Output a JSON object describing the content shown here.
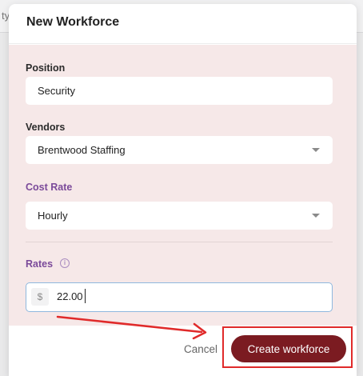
{
  "backdrop": {
    "glyph": "ty"
  },
  "modal": {
    "title": "New Workforce",
    "position": {
      "label": "Position",
      "value": "Security"
    },
    "vendors": {
      "label": "Vendors",
      "value": "Brentwood Staffing"
    },
    "cost_rate": {
      "label": "Cost Rate",
      "value": "Hourly"
    },
    "rates": {
      "label": "Rates",
      "currency_symbol": "$",
      "value": "22.00"
    },
    "footer": {
      "cancel_label": "Cancel",
      "create_label": "Create workforce"
    }
  },
  "icons": {
    "info": "info-icon",
    "caret": "chevron-down-icon"
  },
  "colors": {
    "primary_button": "#7b1b21",
    "section_label_purple": "#7b4a9a",
    "form_background": "#f6e8e8",
    "annotation_red": "#e02a2a"
  }
}
